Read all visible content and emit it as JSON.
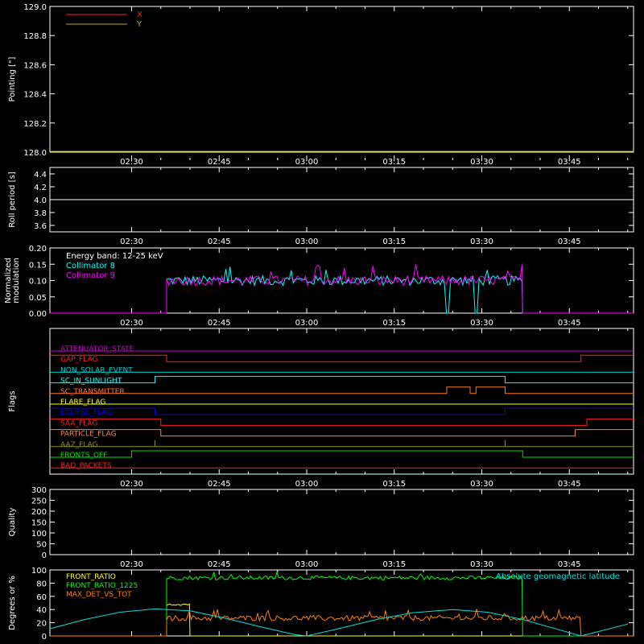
{
  "figure": {
    "background": "#000000",
    "axis_color": "#ffffff"
  },
  "chart_data": [
    {
      "id": "pointing",
      "type": "line",
      "ylabel": "Pointing [\"]",
      "ylim": [
        128.0,
        129.0
      ],
      "yticks": [
        "128.0",
        "128.2",
        "128.4",
        "128.6",
        "128.8",
        "129.0"
      ],
      "xticks": [
        "02:30",
        "02:45",
        "03:00",
        "03:15",
        "03:30",
        "03:45"
      ],
      "legend": {
        "placement": "top-left",
        "entries": [
          {
            "name": "X",
            "color": "#ff2020"
          },
          {
            "name": "Y",
            "color": "#b8b000"
          }
        ]
      }
    },
    {
      "id": "roll",
      "type": "line",
      "ylabel": "Roll period [s]",
      "ylim": [
        3.5,
        4.5
      ],
      "yticks": [
        "3.6",
        "3.8",
        "4.0",
        "4.2",
        "4.4"
      ],
      "xticks": [
        "02:30",
        "02:45",
        "03:00",
        "03:15",
        "03:30",
        "03:45"
      ],
      "series": [
        {
          "y": 4.0,
          "color": "#ffffff"
        }
      ]
    },
    {
      "id": "modulation",
      "type": "line",
      "ylabel": [
        "Normalized",
        "modulation"
      ],
      "ylim": [
        0.0,
        0.2
      ],
      "yticks": [
        "0.00",
        "0.05",
        "0.10",
        "0.15",
        "0.20"
      ],
      "xticks": [
        "02:30",
        "02:45",
        "03:00",
        "03:15",
        "03:30",
        "03:45"
      ],
      "annotation": "Energy band: 12-25 keV",
      "series": [
        {
          "name": "Collimator 8",
          "color": "#00ffff",
          "active": [
            "02:36",
            "03:37"
          ],
          "mean": 0.1,
          "noise": 0.015,
          "dropouts": [
            [
              "03:24",
              "03:29"
            ]
          ]
        },
        {
          "name": "Collimator 9",
          "color": "#ff00ff",
          "active": [
            "02:36",
            "03:37"
          ],
          "mean": 0.1,
          "noise": 0.015
        }
      ]
    },
    {
      "id": "flags",
      "type": "line",
      "ylabel": "Flags",
      "xticks": [
        "02:30",
        "02:45",
        "03:00",
        "03:15",
        "03:30",
        "03:45"
      ],
      "series": [
        {
          "name": "ATTENUATOR_STATE",
          "color": "#cc00cc",
          "segments": [
            [
              "02:16",
              0
            ],
            [
              "03:55",
              0
            ]
          ]
        },
        {
          "name": "GAP_FLAG",
          "color": "#ff2020",
          "segments": [
            [
              "02:16",
              1
            ],
            [
              "02:36",
              0
            ],
            [
              "03:47",
              1
            ],
            [
              "03:55",
              1
            ]
          ]
        },
        {
          "name": "NON_SOLAR_EVENT",
          "color": "#00cccc",
          "segments": [
            [
              "02:16",
              0
            ],
            [
              "03:55",
              0
            ]
          ]
        },
        {
          "name": "SC_IN_SUNLIGHT",
          "color": "#00ffff",
          "segments": [
            [
              "02:16",
              0
            ],
            [
              "02:34",
              1
            ],
            [
              "03:34",
              0
            ],
            [
              "03:55",
              0
            ]
          ]
        },
        {
          "name": "SC_TRANSMITTER",
          "color": "#ff7a2a",
          "segments": [
            [
              "02:16",
              0
            ],
            [
              "03:24",
              1
            ],
            [
              "03:28",
              0
            ],
            [
              "03:29",
              1
            ],
            [
              "03:34",
              0
            ],
            [
              "03:55",
              0
            ]
          ]
        },
        {
          "name": "FLARE_FLAG",
          "color": "#ffff00",
          "segments": [
            [
              "02:16",
              0
            ],
            [
              "03:55",
              0
            ]
          ]
        },
        {
          "name": "ECLIPSE_FLAG",
          "color": "#0000ff",
          "segments": [
            [
              "02:16",
              1
            ],
            [
              "02:34",
              0
            ],
            [
              "03:34",
              1
            ],
            [
              "03:55",
              1
            ]
          ]
        },
        {
          "name": "SAA_FLAG",
          "color": "#ff2020",
          "segments": [
            [
              "02:16",
              1
            ],
            [
              "02:35",
              0
            ],
            [
              "03:48",
              1
            ],
            [
              "03:55",
              1
            ]
          ]
        },
        {
          "name": "PARTICLE_FLAG",
          "color": "#ff8040",
          "segments": [
            [
              "02:16",
              1
            ],
            [
              "02:35",
              0
            ],
            [
              "03:46",
              1
            ],
            [
              "03:55",
              1
            ]
          ]
        },
        {
          "name": "AAZ_FLAG",
          "color": "#909020",
          "segments": [
            [
              "02:16",
              0
            ],
            [
              "02:34",
              1
            ],
            [
              "02:34",
              0
            ],
            [
              "03:34",
              1
            ],
            [
              "03:34",
              0
            ],
            [
              "03:55",
              0
            ]
          ]
        },
        {
          "name": "FRONTS_OFF",
          "color": "#00e000",
          "segments": [
            [
              "02:16",
              0
            ],
            [
              "02:30",
              1
            ],
            [
              "03:37",
              0
            ],
            [
              "03:55",
              0
            ]
          ]
        },
        {
          "name": "BAD_PACKETS",
          "color": "#ff2020",
          "segments": [
            [
              "02:16",
              0
            ],
            [
              "03:55",
              0
            ]
          ]
        }
      ]
    },
    {
      "id": "quality",
      "type": "line",
      "ylabel": "Quality",
      "ylim": [
        0,
        300
      ],
      "yticks": [
        "0",
        "50",
        "100",
        "150",
        "200",
        "250",
        "300"
      ],
      "xticks": [
        "02:30",
        "02:45",
        "03:00",
        "03:15",
        "03:30",
        "03:45"
      ]
    },
    {
      "id": "ratios",
      "type": "line",
      "ylabel": "Degrees or %",
      "ylim": [
        0,
        100
      ],
      "yticks": [
        "0",
        "20",
        "40",
        "60",
        "80",
        "100"
      ],
      "annotation": "Absolute geomagnetic latitude",
      "annotation_color": "#00e0e0",
      "series": [
        {
          "name": "FRONT_RATIO",
          "color": "#ffff00",
          "active": [
            "02:36",
            "02:40"
          ],
          "mean": 48,
          "noise": 2
        },
        {
          "name": "FRONT_RATIO_1225",
          "color": "#00ff00",
          "active": [
            "02:36",
            "03:37"
          ],
          "mean": 88,
          "noise": 3
        },
        {
          "name": "MAX_DET_VS_TOT",
          "color": "#ff8000",
          "active": [
            "02:36",
            "03:47"
          ],
          "mean": 27,
          "noise": 4
        },
        {
          "name": "Absolute geomagnetic latitude",
          "color": "#00e0e0",
          "points": [
            [
              "02:16",
              11
            ],
            [
              "02:22",
              25
            ],
            [
              "02:28",
              36
            ],
            [
              "02:34",
              41
            ],
            [
              "02:40",
              38
            ],
            [
              "02:46",
              27
            ],
            [
              "02:52",
              14
            ],
            [
              "02:58",
              2
            ],
            [
              "03:00",
              0
            ],
            [
              "03:05",
              10
            ],
            [
              "03:12",
              25
            ],
            [
              "03:18",
              35
            ],
            [
              "03:25",
              40
            ],
            [
              "03:31",
              36
            ],
            [
              "03:37",
              25
            ],
            [
              "03:43",
              10
            ],
            [
              "03:47",
              0
            ],
            [
              "03:51",
              9
            ],
            [
              "03:55",
              18
            ]
          ]
        }
      ]
    }
  ]
}
